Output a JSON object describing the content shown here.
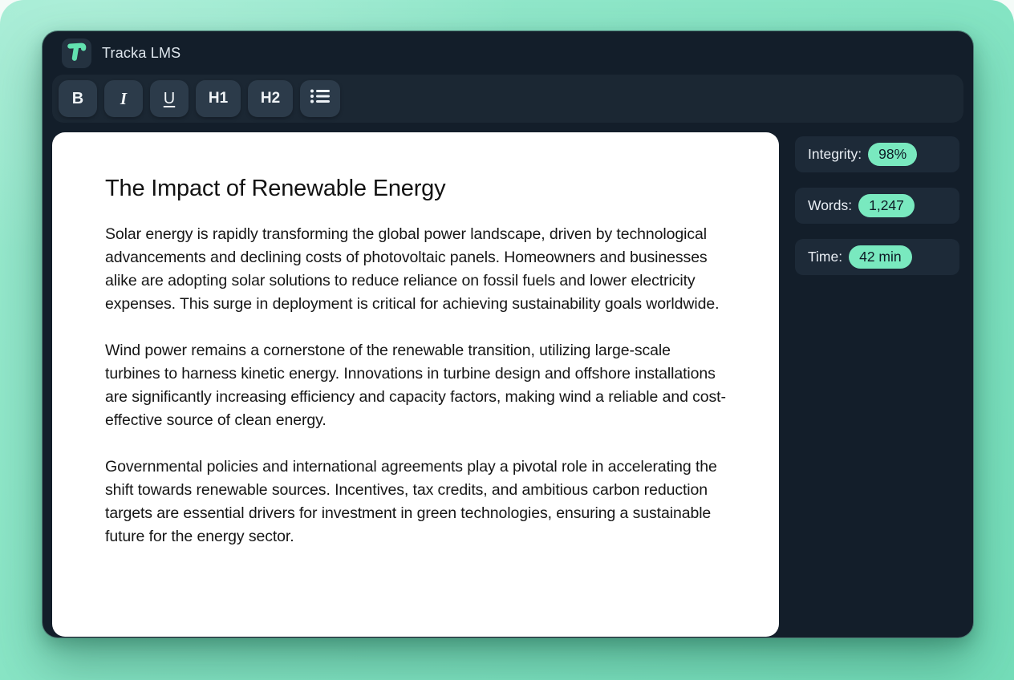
{
  "app": {
    "title": "Tracka LMS"
  },
  "toolbar": {
    "buttons": [
      {
        "id": "bold",
        "label": "B"
      },
      {
        "id": "italic",
        "label": "I"
      },
      {
        "id": "underline",
        "label": "U"
      },
      {
        "id": "heading1",
        "label": "H1"
      },
      {
        "id": "heading2",
        "label": "H2"
      },
      {
        "id": "bullet-list",
        "label": ""
      }
    ]
  },
  "document": {
    "title": "The Impact of Renewable Energy",
    "paragraphs": [
      "Solar energy is rapidly transforming the global power landscape, driven by technological advancements and declining costs of photovoltaic panels. Homeowners and businesses alike are adopting solar solutions to reduce reliance on fossil fuels and lower electricity expenses. This surge in deployment is critical for achieving sustainability goals worldwide.",
      "Wind power remains a cornerstone of the renewable transition, utilizing large-scale turbines to harness kinetic energy. Innovations in turbine design and offshore installations are significantly increasing efficiency and capacity factors, making wind a reliable and cost-effective source of clean energy.",
      "Governmental policies and international agreements play a pivotal role in accelerating the shift towards renewable sources. Incentives, tax credits, and ambitious carbon reduction targets are essential drivers for investment in green technologies, ensuring a sustainable future for the energy sector."
    ]
  },
  "stats": [
    {
      "label": "Integrity:",
      "value": "98%"
    },
    {
      "label": "Words:",
      "value": "1,247"
    },
    {
      "label": "Time:",
      "value": "42 min"
    }
  ],
  "colors": {
    "page_background": "#8ae5c6",
    "window_background": "#131e2a",
    "toolbar_background": "#1b2733",
    "button_background": "#2c3b4a",
    "document_background": "#ffffff",
    "stat_card_background": "#1d2a38",
    "accent_mint": "#79e9bf",
    "logo_glyph": "#62e2b0",
    "text_light": "#e9eef4",
    "text_dark": "#161616"
  }
}
